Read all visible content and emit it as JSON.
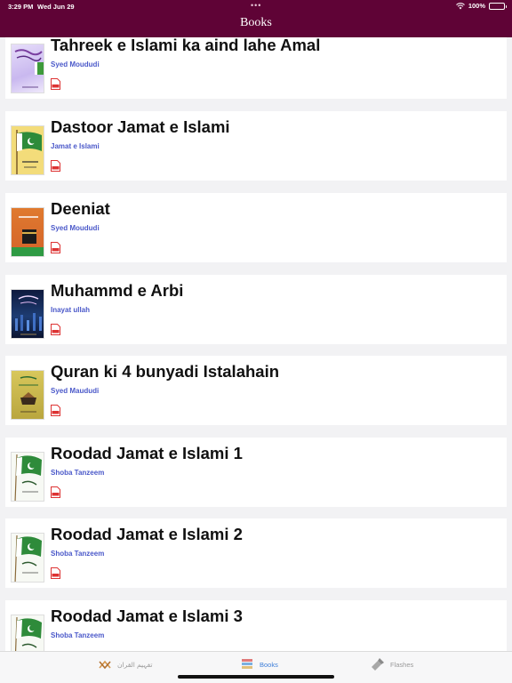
{
  "status_bar": {
    "time": "3:29 PM",
    "date": "Wed Jun 29",
    "battery": "100%",
    "dots": "•••"
  },
  "header": {
    "title": "Books"
  },
  "accent_color": "#5f0336",
  "author_color": "#4a58c9",
  "books": [
    {
      "title": "Tahreek e Islami ka aind lahe Amal",
      "author": "Syed Moududi",
      "file_icon": "pdf-icon"
    },
    {
      "title": "Dastoor Jamat e Islami",
      "author": "Jamat e Islami",
      "file_icon": "pdf-icon"
    },
    {
      "title": "Deeniat",
      "author": "Syed Moududi",
      "file_icon": "pdf-icon"
    },
    {
      "title": "Muhammd e Arbi",
      "author": "Inayat ullah",
      "file_icon": "pdf-icon"
    },
    {
      "title": "Quran ki 4 bunyadi Istalahain",
      "author": "Syed Maududi",
      "file_icon": "pdf-icon"
    },
    {
      "title": "Roodad Jamat e Islami 1",
      "author": "Shoba Tanzeem",
      "file_icon": "pdf-icon"
    },
    {
      "title": "Roodad Jamat e Islami 2",
      "author": "Shoba Tanzeem",
      "file_icon": "pdf-icon"
    },
    {
      "title": "Roodad Jamat e Islami 3",
      "author": "Shoba Tanzeem",
      "file_icon": "pdf-icon"
    }
  ],
  "tabs": [
    {
      "label": "تفہیم القران",
      "icon": "quran-icon",
      "selected": false
    },
    {
      "label": "Books",
      "icon": "books-icon",
      "selected": true
    },
    {
      "label": "Flashes",
      "icon": "flashlight-icon",
      "selected": false
    }
  ]
}
